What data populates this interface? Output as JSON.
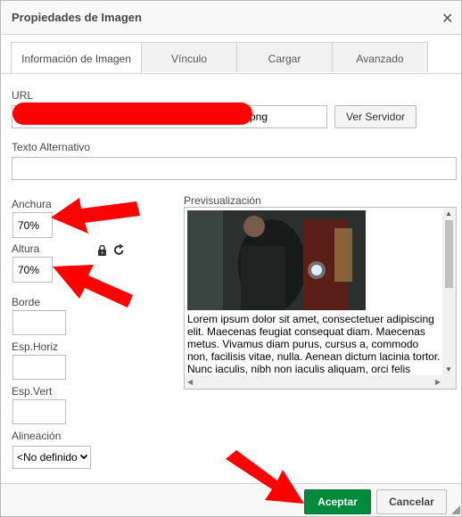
{
  "dialog": {
    "title": "Propiedades de Imagen",
    "close_icon": "close-icon"
  },
  "tabs": [
    {
      "label": "Información de Imagen",
      "active": true
    },
    {
      "label": "Vínculo",
      "active": false
    },
    {
      "label": "Cargar",
      "active": false
    },
    {
      "label": "Avanzado",
      "active": false
    }
  ],
  "info": {
    "url_label": "URL",
    "url_value": "png",
    "browse_server_label": "Ver Servidor",
    "alt_label": "Texto Alternativo",
    "alt_value": "",
    "width_label": "Anchura",
    "width_value": "70%",
    "height_label": "Altura",
    "height_value": "70%",
    "lock_icon": "lock-icon",
    "reset_icon": "reset-size-icon",
    "border_label": "Borde",
    "border_value": "",
    "hspace_label": "Esp.Horiz",
    "hspace_value": "",
    "vspace_label": "Esp.Vert",
    "vspace_value": "",
    "align_label": "Alineación",
    "align_selected": "<No definido>"
  },
  "preview": {
    "label": "Previsualización",
    "text": "Lorem ipsum dolor sit amet, consectetuer adipiscing elit. Maecenas feugiat consequat diam. Maecenas metus. Vivamus diam purus, cursus a, commodo non, facilisis vitae, nulla. Aenean dictum lacinia tortor. Nunc iaculis, nibh non iaculis aliquam, orci felis"
  },
  "footer": {
    "ok_label": "Aceptar",
    "cancel_label": "Cancelar"
  },
  "colors": {
    "ok_button": "#008a3e",
    "redaction": "#ff0000",
    "arrows": "#ff0000"
  }
}
